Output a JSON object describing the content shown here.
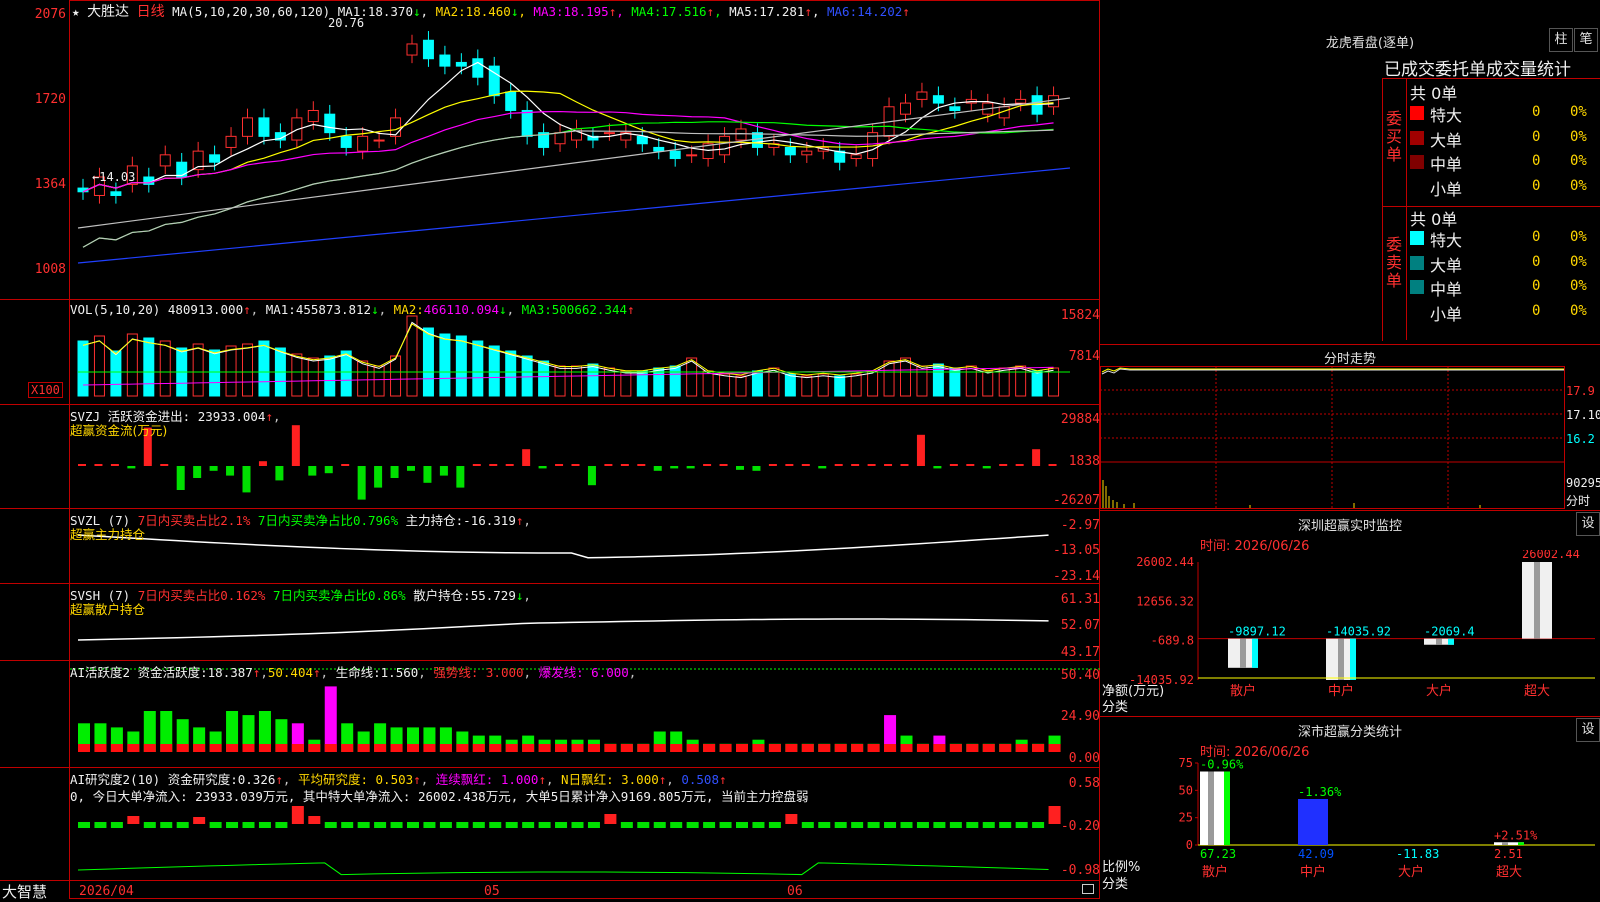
{
  "kline": {
    "star": "★",
    "name": "大胜达",
    "period": "日线",
    "ma_label": "MA(5,10,20,30,60,120)",
    "ma_values": [
      {
        "label": "MA1:",
        "value": "18.370",
        "arrow": "↓",
        "color": "#ffffff"
      },
      {
        "label": "MA2:",
        "value": "18.460",
        "arrow": "↓",
        "color": "#ffff00"
      },
      {
        "label": "MA3:",
        "value": "18.195",
        "arrow": "↑",
        "color": "#ff00ff"
      },
      {
        "label": "MA4:",
        "value": "17.516",
        "arrow": "↑",
        "color": "#00ff00"
      },
      {
        "label": "MA5:",
        "value": "17.281",
        "arrow": "↑",
        "color": "#c0c0c0"
      },
      {
        "label": "MA6:",
        "value": "14.202",
        "arrow": "↑",
        "color": "#3050ff"
      }
    ],
    "y_labels": [
      "2076",
      "1720",
      "1364",
      "1008"
    ],
    "max_label": "20.76",
    "min_label": "←14.03"
  },
  "vol": {
    "title": "VOL(5,10,20)",
    "value": "480913.000",
    "ma1": "455873.812",
    "ma2": "466110.094",
    "ma3": "500662.344",
    "y_labels": [
      "15824",
      "7814"
    ],
    "unit": "X100"
  },
  "svzj": {
    "title": "SVZJ",
    "label1": "活跃资金进出:",
    "value": "23933.004",
    "subtitle": "超赢资金流(万元)",
    "y_labels": [
      "29884",
      "1838",
      "-26207"
    ]
  },
  "svzl": {
    "title": "SVZL (7)",
    "buy": "7日内买卖占比2.1%",
    "net": "7日内买卖净占比0.796%",
    "hold": "主力持仓:",
    "hold_value": "-16.319",
    "subtitle": "超赢主力持仓",
    "y_labels": [
      "-2.97",
      "-13.05",
      "-23.14"
    ]
  },
  "svsh": {
    "title": "SVSH (7)",
    "buy": "7日内买卖占比0.162%",
    "net": "7日内买卖净占比0.86%",
    "hold": "散户持仓:",
    "hold_value": "55.729",
    "subtitle": "超赢散户持仓",
    "y_labels": [
      "61.31",
      "52.07",
      "43.17"
    ]
  },
  "ai_active": {
    "title": "AI活跃度2",
    "label": "资金活跃度:",
    "value": "18.387",
    "value2": "50.404",
    "life_label": "生命线:",
    "life": "1.560",
    "strong": "强势线: 3.000",
    "burst": "爆发线: 6.000",
    "y_labels": [
      "50.40",
      "24.90",
      "0.00"
    ]
  },
  "ai_research": {
    "title": "AI研究度2(10)",
    "label": "资金研究度:",
    "value": "0.326",
    "avg": "平均研究度: 0.503",
    "cont": "连续飘红: 1.000",
    "nred": "N日飘红: 3.000",
    "v5": "0.508",
    "desc": "0, 今日大单净流入: 23933.039万元, 其中特大单净流入: 26002.438万元, 大单5日累计净入9169.805万元, 当前主力控盘弱",
    "y_labels": [
      "0.58",
      "-0.20",
      "-0.98"
    ]
  },
  "bottom": {
    "brand": "大智慧",
    "date1": "2026/04",
    "m05": "05",
    "m06": "06"
  },
  "longhu": {
    "title": "龙虎看盘(逐单)",
    "btn1": "柱",
    "btn2": "笔",
    "header": "已成交委托单成交量统计",
    "buy_title": "委买单",
    "sell_title": "委卖单",
    "buy_total": "共 0单",
    "sell_total": "共 0单",
    "rows": [
      {
        "label": "特大",
        "v1": "0",
        "v2": "0%"
      },
      {
        "label": "大单",
        "v1": "0",
        "v2": "0%"
      },
      {
        "label": "中单",
        "v1": "0",
        "v2": "0%"
      },
      {
        "label": "小单",
        "v1": "0",
        "v2": "0%"
      }
    ]
  },
  "fenshi": {
    "title": "分时走势",
    "y_labels": [
      "17.9",
      "17.10",
      "16.2",
      "90295"
    ],
    "unit": "分时"
  },
  "monitor": {
    "title": "深圳超赢实时监控",
    "btn": "设",
    "time": "时间: 2026/06/26",
    "y_labels": [
      "26002.44",
      "12656.32",
      "-689.8",
      "-14035.92"
    ],
    "ylabel": "净额(万元)",
    "xlabel": "分类",
    "cats": [
      "散户",
      "中户",
      "大户",
      "超大"
    ],
    "values": [
      "-9897.12",
      "-14035.92",
      "-2069.4",
      "26002.44"
    ]
  },
  "classify": {
    "title": "深市超赢分类统计",
    "btn": "设",
    "time": "时间: 2026/06/26",
    "y_labels": [
      "75",
      "50",
      "25",
      "0"
    ],
    "ylabel": "比例%",
    "xlabel": "分类",
    "cats": [
      "散户",
      "中户",
      "大户",
      "超大"
    ],
    "top_labels": [
      "-0.96%",
      "-1.36%",
      "",
      "+2.51%"
    ],
    "values": [
      "67.23",
      "42.09",
      "-11.83",
      "2.51"
    ]
  },
  "chart_data": [
    {
      "type": "bar",
      "title": "深圳超赢实时监控",
      "ylabel": "净额(万元)",
      "xlabel": "分类",
      "categories": [
        "散户",
        "中户",
        "大户",
        "超大"
      ],
      "values": [
        -9897.12,
        -14035.92,
        -2069.4,
        26002.44
      ],
      "ylim": [
        -14035.92,
        26002.44
      ]
    },
    {
      "type": "bar",
      "title": "深市超赢分类统计",
      "ylabel": "比例%",
      "xlabel": "分类",
      "categories": [
        "散户",
        "中户",
        "大户",
        "超大"
      ],
      "values": [
        67.23,
        42.09,
        -11.83,
        2.51
      ],
      "ylim": [
        0,
        75
      ]
    }
  ]
}
